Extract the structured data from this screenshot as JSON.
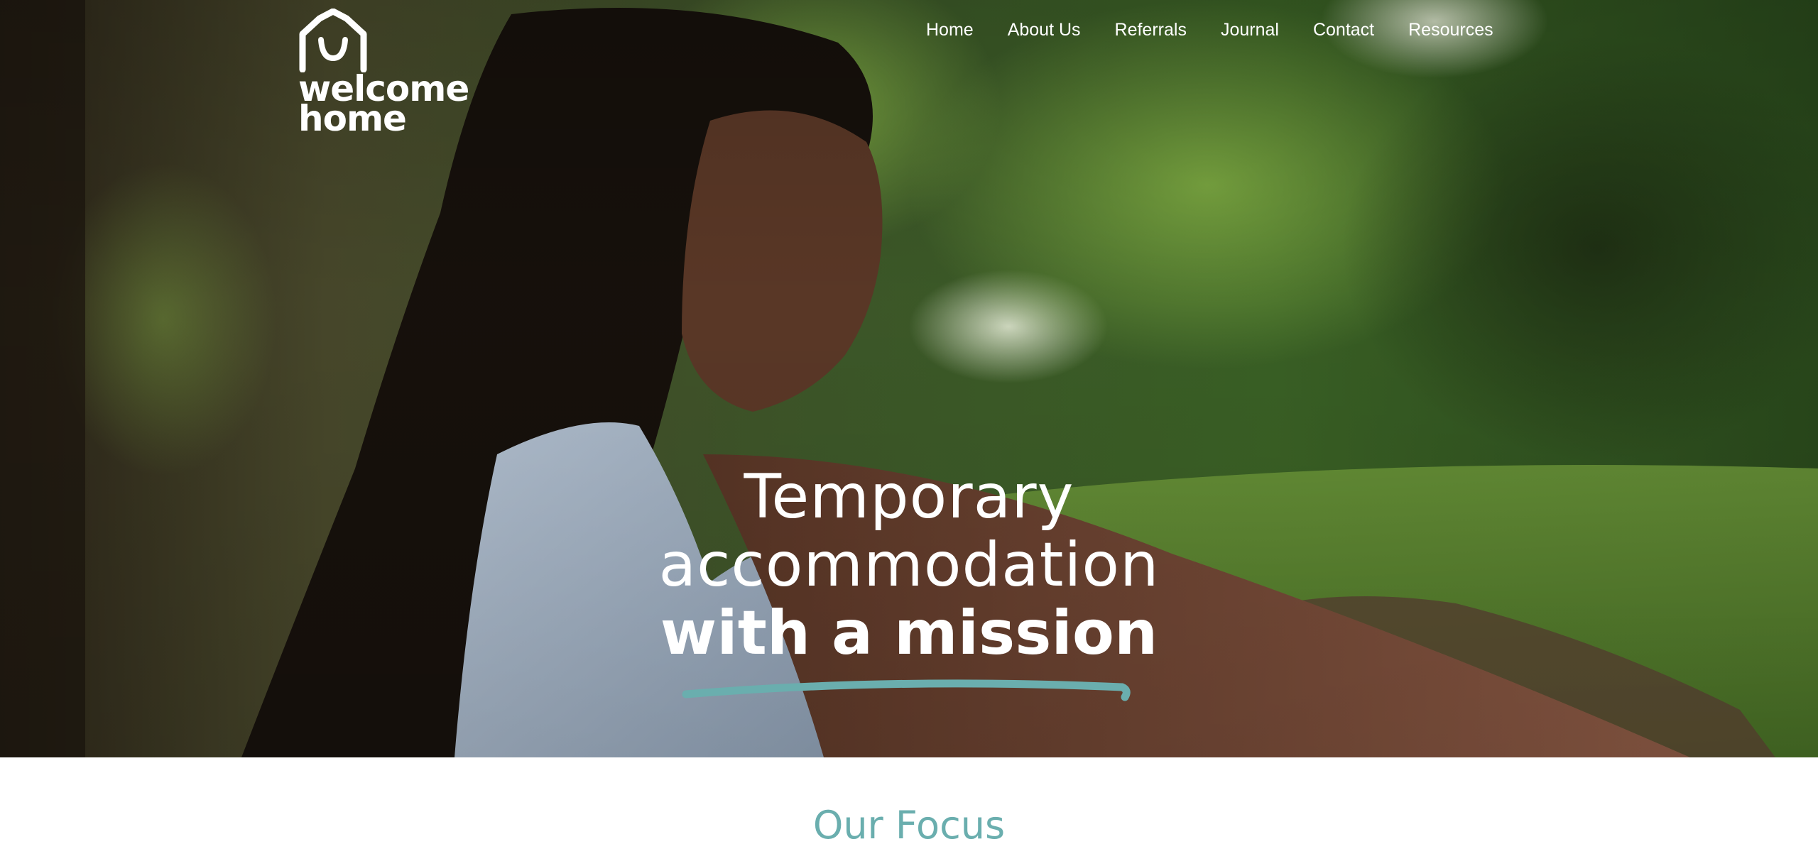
{
  "brand": {
    "logo_line1": "welcome",
    "logo_line2": "home",
    "logo_icon": "house-smile-icon",
    "accent_color": "#6aaeae"
  },
  "nav": {
    "items": [
      {
        "label": "Home"
      },
      {
        "label": "About Us"
      },
      {
        "label": "Referrals"
      },
      {
        "label": "Journal"
      },
      {
        "label": "Contact"
      },
      {
        "label": "Resources"
      }
    ]
  },
  "hero": {
    "line1": "Temporary",
    "line2": "accommodation",
    "line3": "with a mission",
    "underline_color": "#6aaeae"
  },
  "focus": {
    "heading": "Our Focus"
  }
}
